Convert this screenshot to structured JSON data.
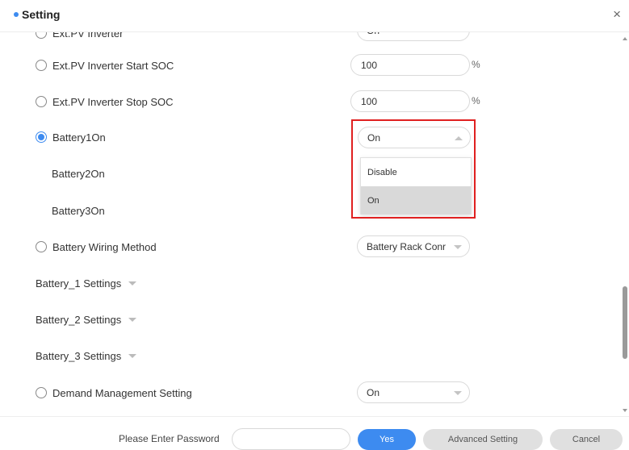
{
  "header": {
    "title": "Setting",
    "close_glyph": "×"
  },
  "rows": {
    "partial_label": "Ext.PV Inverter",
    "partial_value": "On",
    "start_soc": {
      "label": "Ext.PV Inverter Start SOC",
      "value": "100",
      "unit": "%"
    },
    "stop_soc": {
      "label": "Ext.PV Inverter Stop SOC",
      "value": "100",
      "unit": "%"
    },
    "battery1": {
      "label": "Battery1On",
      "value": "On",
      "checked": true
    },
    "battery2": {
      "label": "Battery2On"
    },
    "battery3": {
      "label": "Battery3On"
    },
    "wiring": {
      "label": "Battery Wiring Method",
      "value": "Battery Rack Conr"
    },
    "bat1_settings": {
      "label": "Battery_1 Settings"
    },
    "bat2_settings": {
      "label": "Battery_2 Settings"
    },
    "bat3_settings": {
      "label": "Battery_3 Settings"
    },
    "demand": {
      "label": "Demand Management Setting",
      "value": "On"
    }
  },
  "dropdown": {
    "options": [
      "Disable",
      "On"
    ],
    "selected": "On",
    "highlight_color": "#e02020"
  },
  "footer": {
    "password_label": "Please Enter Password",
    "password_placeholder": "",
    "yes_label": "Yes",
    "advanced_label": "Advanced Setting",
    "cancel_label": "Cancel"
  },
  "colors": {
    "accent": "#3d8bf0",
    "highlight": "#e02020"
  }
}
